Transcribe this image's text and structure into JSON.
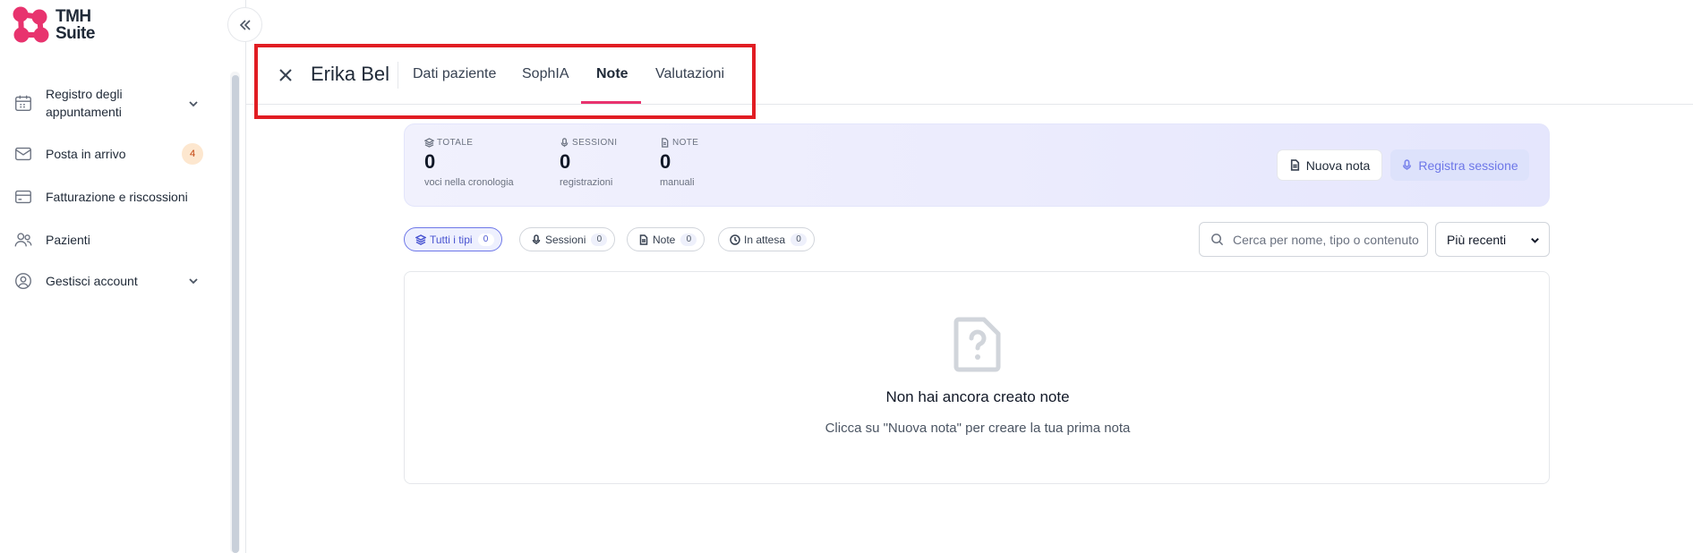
{
  "brand": {
    "line1": "TMH",
    "line2": "Suite"
  },
  "sidebar": {
    "items": [
      {
        "label_line1": "Registro degli",
        "label_line2": "appuntamenti",
        "icon": "calendar-icon",
        "has_chevron": true
      },
      {
        "label": "Posta in arrivo",
        "icon": "mail-icon",
        "badge": "4"
      },
      {
        "label": "Fatturazione e riscossioni",
        "icon": "credit-card-icon"
      },
      {
        "label": "Pazienti",
        "icon": "users-icon"
      },
      {
        "label": "Gestisci account",
        "icon": "user-circle-icon",
        "has_chevron": true
      }
    ]
  },
  "header": {
    "patient_name": "Erika Bel",
    "tabs": [
      {
        "label": "Dati paziente",
        "active": false
      },
      {
        "label": "SophIA",
        "active": false
      },
      {
        "label": "Note",
        "active": true
      },
      {
        "label": "Valutazioni",
        "active": false
      }
    ],
    "highlight_color": "#e11d23",
    "accent_color": "#e8336e"
  },
  "stats": {
    "totale": {
      "label": "TOTALE",
      "value": "0",
      "sub": "voci nella cronologia"
    },
    "sessioni": {
      "label": "SESSIONI",
      "value": "0",
      "sub": "registrazioni"
    },
    "note": {
      "label": "NOTE",
      "value": "0",
      "sub": "manuali"
    },
    "new_note_label": "Nuova nota",
    "record_label": "Registra sessione"
  },
  "filters": {
    "chips": [
      {
        "label": "Tutti i tipi",
        "count": "0",
        "active": true
      },
      {
        "label": "Sessioni",
        "count": "0"
      },
      {
        "label": "Note",
        "count": "0"
      },
      {
        "label": "In attesa",
        "count": "0"
      }
    ],
    "search_placeholder": "Cerca per nome, tipo o contenuto",
    "sort_value": "Più recenti"
  },
  "empty": {
    "title": "Non hai ancora creato note",
    "subtitle": "Clicca su \"Nuova nota\" per creare la tua prima nota"
  }
}
